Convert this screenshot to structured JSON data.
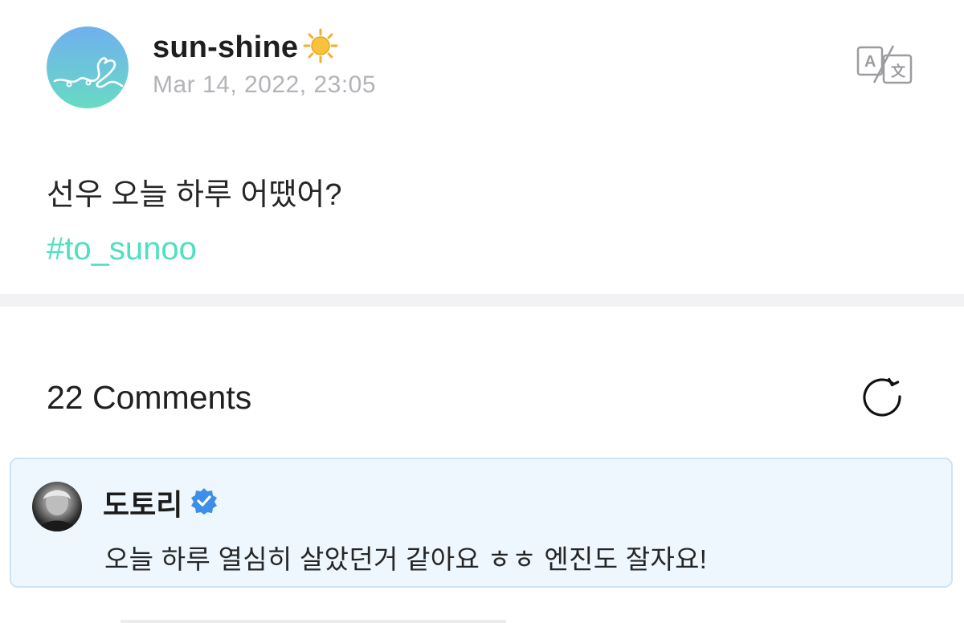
{
  "post": {
    "username": "sun-shine",
    "username_emoji": "sun-emoji-icon",
    "timestamp": "Mar 14, 2022, 23:05",
    "text": "선우 오늘 하루 어땠어?",
    "hashtag": "#to_sunoo",
    "translate_icon": "translate-icon"
  },
  "comments": {
    "count_label": "22 Comments",
    "refresh_icon": "refresh-icon",
    "items": [
      {
        "author": "도토리",
        "verified_icon": "verified-badge-icon",
        "text": "오늘 하루 열심히 살았던거 같아요 ㅎㅎ 엔진도 잘자요!"
      }
    ]
  },
  "colors": {
    "hashtag": "#4ee0c0",
    "timestamp": "#b3b3b8",
    "comment_bg": "#eef7fd",
    "comment_border": "#cfe3f3",
    "verified": "#3d8ee8",
    "divider": "#f2f2f4"
  }
}
